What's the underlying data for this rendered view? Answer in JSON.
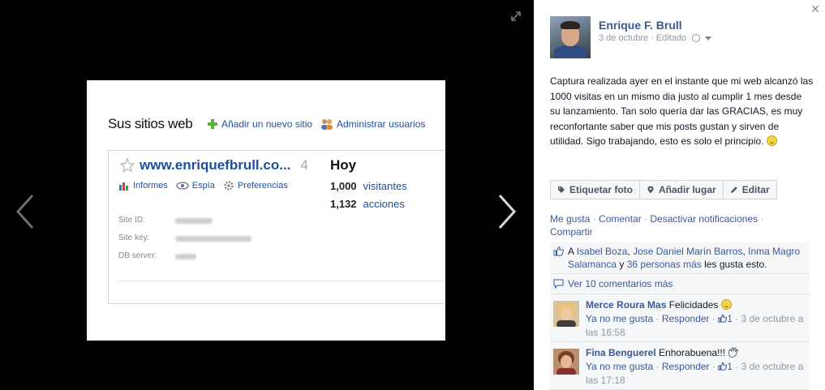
{
  "photo": {
    "title": "Sus sitios web",
    "add_site": "Añadir un nuevo sitio",
    "manage_users": "Administrar usuarios",
    "site_name": "www.enriquefbrull.co...",
    "site_count": "4",
    "tools": [
      "Informes",
      "Espía",
      "Preferencias"
    ],
    "today": "Hoy",
    "stats": [
      {
        "value": "1,000",
        "label": "visitantes"
      },
      {
        "value": "1,132",
        "label": "acciones"
      }
    ],
    "meta_labels": [
      "Site ID:",
      "Site key:",
      "DB server:"
    ]
  },
  "post": {
    "author": "Enrique F. Brull",
    "date": "3 de octubre",
    "separator": "·",
    "edited": "Editado",
    "text": "Captura realizada ayer en el instante que mi web alcanzó las 1000 visitas en un mismo dia justo al cumplir 1 mes desde su lanzamiento. Tan solo quería dar las GRACIAS, es muy reconfortante saber que mis posts gustan y sirven de utilidad. Sigo trabajando, esto es solo el principio."
  },
  "actions": {
    "tag": "Etiquetar foto",
    "place": "Añadir lugar",
    "edit": "Editar"
  },
  "ufi": {
    "like": "Me gusta",
    "comment": "Comentar",
    "disable_notifications": "Desactivar notificaciones",
    "share": "Compartir",
    "likes_prefix": "A",
    "liker1": "Isabel Boza",
    "liker2": "Jose Daniel Marín Barros",
    "liker3": "Inma Magro Salamanca",
    "and": "y",
    "others": "36 personas más",
    "likes_suffix": "les gusta esto.",
    "view_more": "Ver 10 comentarios más"
  },
  "comments": [
    {
      "name": "Merce Roura Mas",
      "text": "Felicidades",
      "unlike": "Ya no me gusta",
      "reply": "Responder",
      "likes": "1",
      "time": "3 de octubre a las 16:58"
    },
    {
      "name": "Fina Benguerel",
      "text": "Enhorabuena!!!",
      "unlike": "Ya no me gusta",
      "reply": "Responder",
      "likes": "1",
      "time": "3 de octubre a las 17:18"
    }
  ],
  "icons": {
    "prev": "chevron-left-icon",
    "next": "chevron-right-icon",
    "expand": "expand-icon",
    "close": "close-icon",
    "audience": "globe-icon"
  },
  "colors": {
    "link": "#3b5998",
    "stage": "#000000",
    "ufi_bg": "#f6f7f9"
  }
}
